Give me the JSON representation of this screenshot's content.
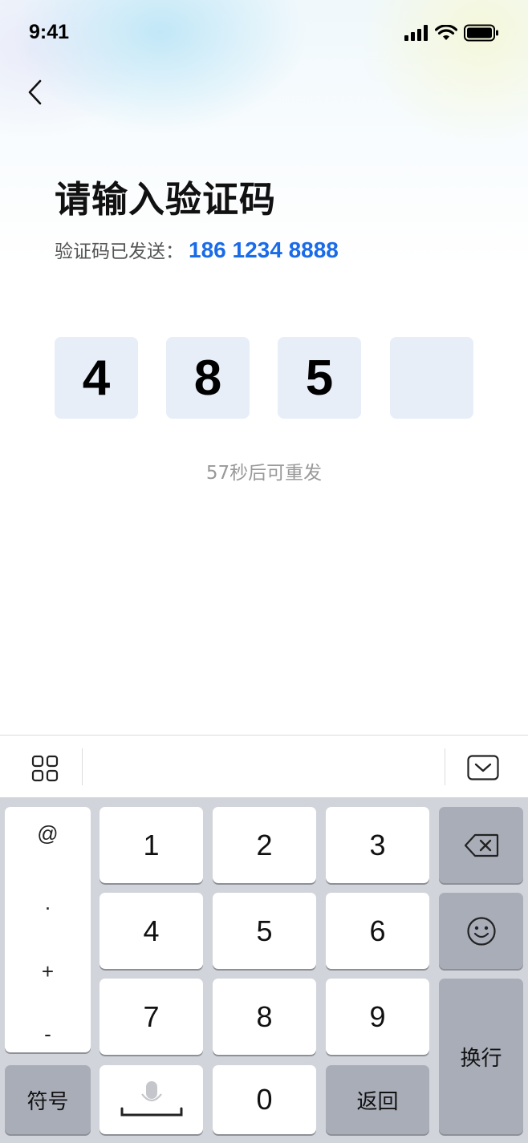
{
  "status_bar": {
    "time": "9:41"
  },
  "page": {
    "title": "请输入验证码",
    "sent_prefix": "验证码已发送：",
    "phone": "186 1234 8888",
    "code_digits": [
      "4",
      "8",
      "5",
      ""
    ],
    "resend_text": "57秒后可重发"
  },
  "keyboard": {
    "symbols": [
      "@",
      ".",
      "+",
      "-"
    ],
    "digits": [
      "1",
      "2",
      "3",
      "4",
      "5",
      "6",
      "7",
      "8",
      "9",
      "0"
    ],
    "symbol_key": "符号",
    "return_key": "返回",
    "newline_key": "换行"
  },
  "icons": {
    "back": "chevron-left-icon",
    "grid": "grid-icon",
    "collapse": "keyboard-collapse-icon",
    "delete": "backspace-icon",
    "emoji": "smiley-icon",
    "mic": "microphone-icon"
  },
  "colors": {
    "accent": "#1a6be8",
    "code_box": "#e8eef7"
  }
}
